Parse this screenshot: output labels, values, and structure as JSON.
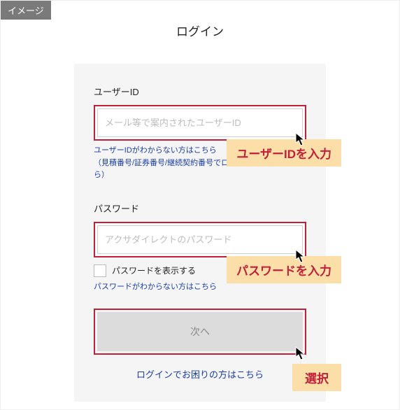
{
  "badge": "イメージ",
  "page_title": "ログイン",
  "user_id": {
    "label": "ユーザーID",
    "placeholder": "メール等で案内されたユーザーID",
    "help1": "ユーザーIDがわからない方はこちら",
    "help2": "（見積番号/証券番号/継続契約番号でログインする方もこちら）"
  },
  "password": {
    "label": "パスワード",
    "placeholder": "アクサダイレクトのパスワード",
    "show_checkbox_label": "パスワードを表示する",
    "help": "パスワードがわからない方はこちら"
  },
  "next_button": "次へ",
  "trouble_link": "ログインでお困りの方はこちら",
  "annotations": {
    "user_id_callout": "ユーザーIDを入力",
    "password_callout": "パスワードを入力",
    "select_callout": "選択"
  },
  "colors": {
    "highlight_border": "#c2203a",
    "callout_bg": "#fcdfa8",
    "callout_text": "#c2203a",
    "link": "#1a3ea8"
  }
}
